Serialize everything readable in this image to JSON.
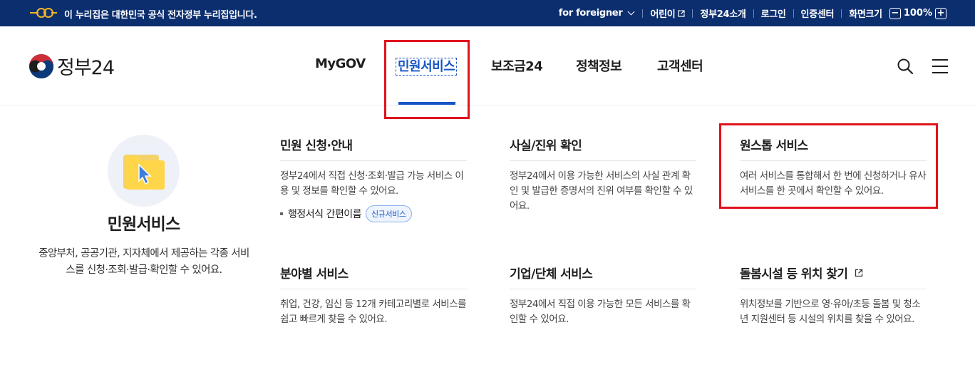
{
  "topbar": {
    "notice": "이 누리집은 대한민국 공식 전자정부 누리집입니다.",
    "foreigner": "for foreigner",
    "kids": "어린이",
    "about": "정부24소개",
    "login": "로그인",
    "cert": "인증센터",
    "font_size": "화면크기",
    "zoom_minus": "−",
    "zoom_value": "100%",
    "zoom_plus": "+"
  },
  "brand": {
    "name": "정부24"
  },
  "gnb": {
    "items": [
      "MyGOV",
      "민원서비스",
      "보조금24",
      "정책정보",
      "고객센터"
    ],
    "active": "민원서비스"
  },
  "intro": {
    "title": "민원서비스",
    "desc": "중앙부처, 공공기관, 지자체에서 제공하는 각종 서비스를 신청·조회·발급·확인할 수 있어요."
  },
  "cards": [
    {
      "title": "민원 신청·안내",
      "desc": "정부24에서 직접 신청·조회·발급 가능 서비스 이용 및 정보를 확인할 수 있어요.",
      "link": "행정서식 간편이름",
      "badge": "신규서비스"
    },
    {
      "title": "사실/진위 확인",
      "desc": "정부24에서 이용 가능한 서비스의 사실 관계 확인 및 발급한 증명서의 진위 여부를 확인할 수 있어요."
    },
    {
      "title": "원스톱 서비스",
      "desc": "여러 서비스를 통합해서 한 번에 신청하거나 유사 서비스를 한 곳에서 확인할 수 있어요."
    },
    {
      "title": "분야별 서비스",
      "desc": "취업, 건강, 임신 등 12개 카테고리별로 서비스를 쉽고 빠르게 찾을 수 있어요."
    },
    {
      "title": "기업/단체 서비스",
      "desc": "정부24에서 직접 이용 가능한 모든 서비스를 확인할 수 있어요."
    },
    {
      "title": "돌봄시설 등 위치 찾기",
      "desc": "위치정보를 기반으로 영·유아/초등 돌봄 및 청소년 지원센터 등 시설의 위치를 찾을 수 있어요."
    }
  ],
  "colors": {
    "topbar_bg": "#0b2e6f",
    "accent": "#1755c6",
    "highlight": "#e0131b"
  },
  "icons": [
    "gov-emblem-icon",
    "taegeuk-logo-icon",
    "external-link-icon",
    "chevron-down-icon",
    "search-icon",
    "hamburger-menu-icon",
    "folder-cursor-icon"
  ]
}
